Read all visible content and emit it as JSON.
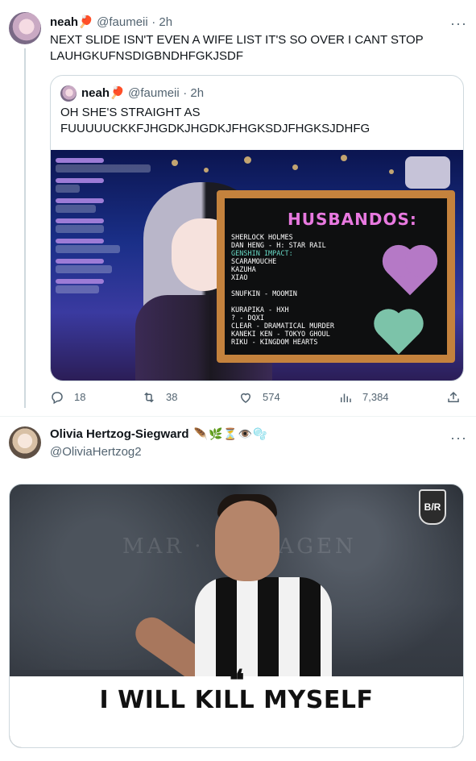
{
  "tweet1": {
    "display_name": "neah🏓",
    "handle": "@faumeii",
    "time": "· 2h",
    "text_line1": "NEXT SLIDE ISN'T EVEN A WIFE LIST IT'S SO OVER I CANT STOP",
    "text_line2": "LAUHGKUFNSDIGBNDHFGKJSDF",
    "quote": {
      "display_name": "neah🏓",
      "handle": "@faumeii",
      "time": "· 2h",
      "text_line1": "OH SHE'S STRAIGHT AS",
      "text_line2": "FUUUUUCKKFJHGDKJHGDKJFHGKSDJFHGKSJDHFG",
      "board": {
        "title": "HUSBANDOS:",
        "items": [
          {
            "text": "SHERLOCK HOLMES",
            "accent": false
          },
          {
            "text": "DAN HENG - H: STAR RAIL",
            "accent": false
          },
          {
            "text": "GENSHIN IMPACT:",
            "accent": true
          },
          {
            "text": "SCARAMOUCHE",
            "accent": false
          },
          {
            "text": "KAZUHA",
            "accent": false
          },
          {
            "text": "XIAO",
            "accent": false
          },
          {
            "text": "",
            "accent": false
          },
          {
            "text": "SNUFKIN - MOOMIN",
            "accent": false
          },
          {
            "text": "",
            "accent": false
          },
          {
            "text": "KURAPIKA - HXH",
            "accent": false
          },
          {
            "text": "? - DQXI",
            "accent": false
          },
          {
            "text": "CLEAR - DRAMATICAL MURDER",
            "accent": false
          },
          {
            "text": "KANEKI KEN - TOKYO GHOUL",
            "accent": false
          },
          {
            "text": "RIKU - KINGDOM HEARTS",
            "accent": false
          }
        ]
      }
    },
    "actions": {
      "replies": "18",
      "retweets": "38",
      "likes": "574",
      "views": "7,384"
    }
  },
  "tweet2": {
    "display_name": "Olivia Hertzog-Siegward",
    "emoji": "🪶🌿⏳👁️🫧",
    "handle": "@OliviaHertzog2",
    "media": {
      "logo": "B/R",
      "caption": "I WILL KILL MYSELF",
      "quote_mark": "❝"
    }
  },
  "icons": {
    "more": "more-icon",
    "reply": "reply-icon",
    "retweet": "retweet-icon",
    "like": "like-icon",
    "views": "views-icon",
    "share": "share-icon"
  },
  "colors": {
    "text": "#0f1419",
    "secondary": "#536471",
    "border": "#cfd9de",
    "board_title": "#e879e0",
    "board_accent": "#67d7c4"
  }
}
